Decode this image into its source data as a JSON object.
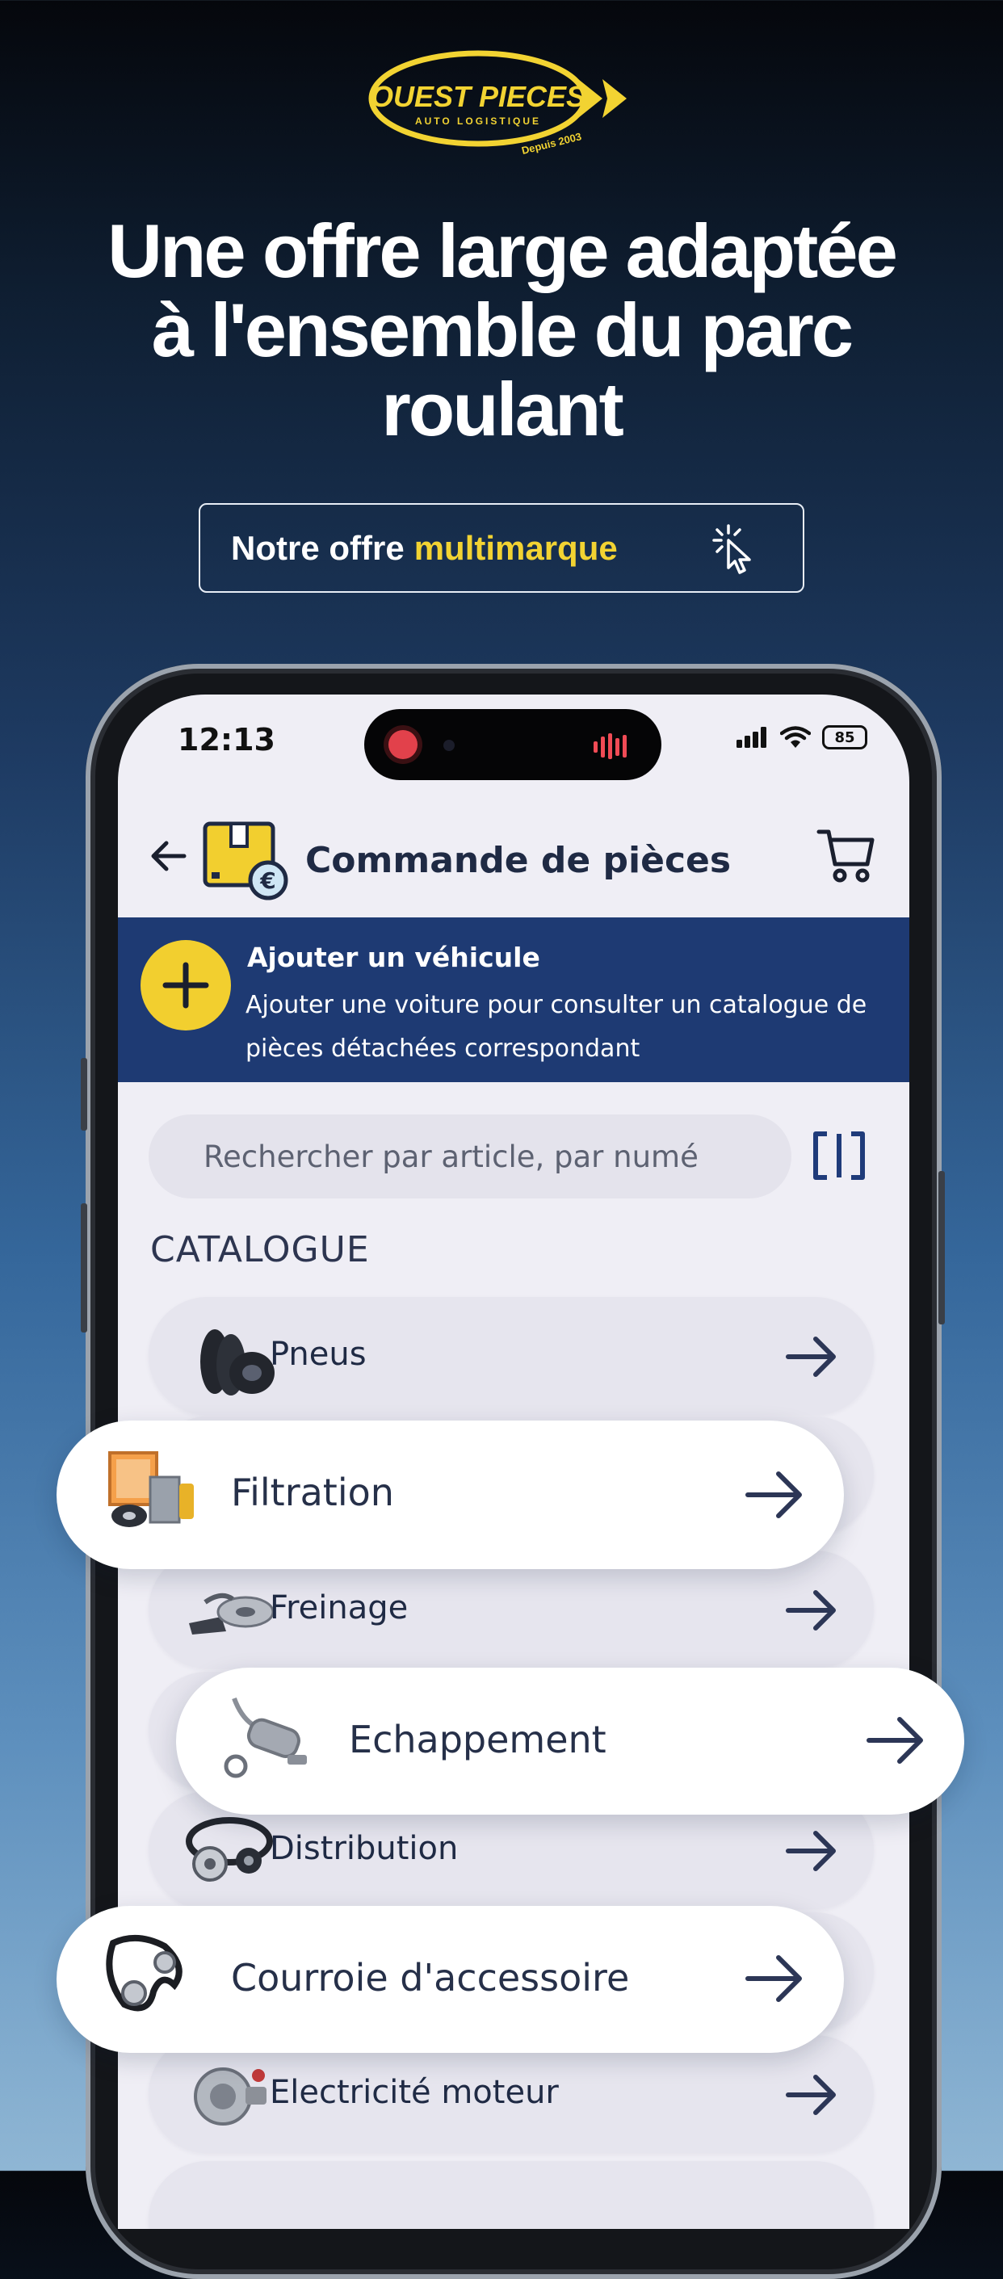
{
  "brand": {
    "name": "OUEST PIECES",
    "tagline": "AUTO LOGISTIQUE",
    "since": "Depuis 2003"
  },
  "headline": {
    "line1": "Une offre large adaptée",
    "line2": "à l'ensemble du parc",
    "line3": "roulant"
  },
  "cta": {
    "label_prefix": "Notre offre",
    "label_accent": "multimarque",
    "icon": "cursor-click-icon"
  },
  "colors": {
    "accent_yellow": "#f2d332",
    "banner_blue": "#1e3a73",
    "text_navy": "#1f2a44"
  },
  "phone": {
    "status_bar": {
      "time": "12:13",
      "battery": "85"
    },
    "app_bar": {
      "title": "Commande de pièces",
      "back_icon": "arrow-left-icon",
      "title_icon": "parcel-euro-icon",
      "cart_icon": "cart-icon"
    },
    "vehicle_banner": {
      "title": "Ajouter un véhicule",
      "description": "Ajouter une voiture pour consulter un catalogue de pièces détachées correspondant",
      "button_icon": "plus-icon"
    },
    "search": {
      "placeholder": "Rechercher par article, par numé",
      "scan_icon": "barcode-scan-icon"
    },
    "catalogue": {
      "title": "CATALOGUE",
      "items": [
        {
          "label": "Pneus",
          "icon": "tires-icon"
        },
        {
          "label": "Filtration",
          "icon": "filters-icon"
        },
        {
          "label": "Freinage",
          "icon": "brake-disc-icon"
        },
        {
          "label": "Echappement",
          "icon": "exhaust-icon"
        },
        {
          "label": "Distribution",
          "icon": "timing-belt-icon"
        },
        {
          "label": "Courroie d'accessoire",
          "icon": "accessory-belt-icon"
        },
        {
          "label": "Electricité moteur",
          "icon": "alternator-icon"
        }
      ]
    }
  }
}
